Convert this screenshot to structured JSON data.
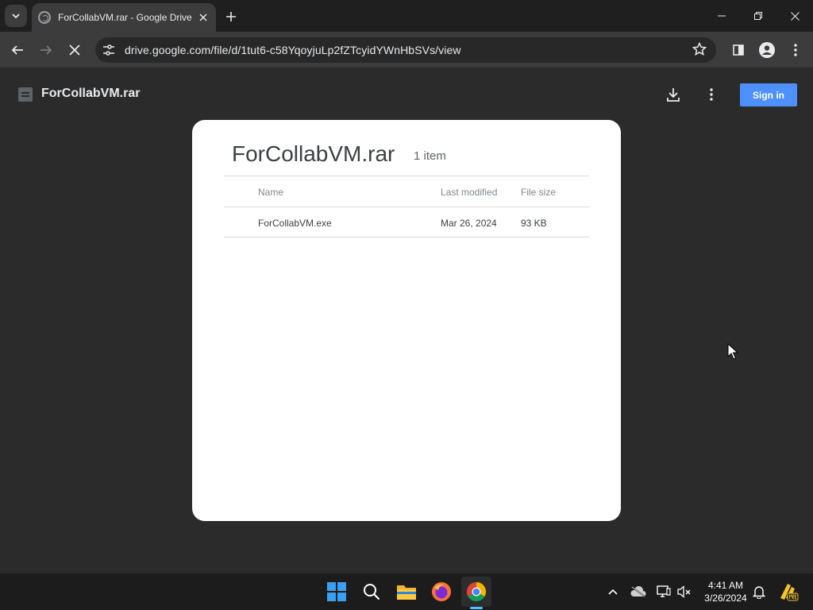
{
  "browser": {
    "tab": {
      "title": "ForCollabVM.rar - Google Drive"
    },
    "url": "drive.google.com/file/d/1tut6-c58YqoyjuLp2fZTcyidYWnHbSVs/view"
  },
  "drive": {
    "file_title": "ForCollabVM.rar",
    "sign_in_label": "Sign in"
  },
  "archive": {
    "title": "ForCollabVM.rar",
    "count": "1 item",
    "columns": [
      "Name",
      "Last modified",
      "File size"
    ],
    "rows": [
      {
        "name": "ForCollabVM.exe",
        "modified": "Mar 26, 2024",
        "size": "93 KB"
      }
    ]
  },
  "taskbar": {
    "time": "4:41 AM",
    "date": "3/26/2024"
  },
  "colors": {
    "accent_button": "#4d90fe",
    "taskbar_active": "#4cc2ff"
  }
}
